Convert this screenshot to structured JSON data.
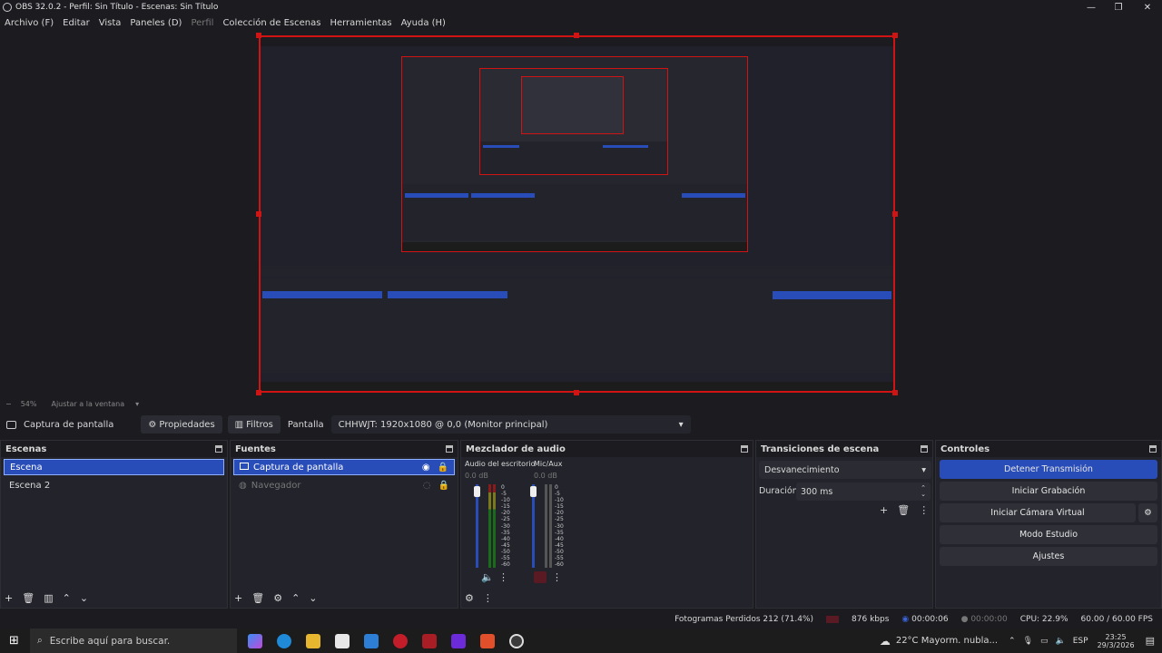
{
  "window": {
    "title": "OBS 32.0.2 - Perfil: Sin Título - Escenas: Sin Título",
    "min": "—",
    "max": "❐",
    "close": "✕"
  },
  "menu": [
    {
      "label": "Archivo (F)",
      "disabled": false
    },
    {
      "label": "Editar",
      "disabled": false
    },
    {
      "label": "Vista",
      "disabled": false
    },
    {
      "label": "Paneles (D)",
      "disabled": false
    },
    {
      "label": "Perfil",
      "disabled": true
    },
    {
      "label": "Colección de Escenas",
      "disabled": false
    },
    {
      "label": "Herramientas",
      "disabled": false
    },
    {
      "label": "Ayuda (H)",
      "disabled": false
    }
  ],
  "zoom": {
    "minus": "−",
    "value": "54%",
    "fit": "Ajustar a la ventana"
  },
  "source_bar": {
    "source_name": "Captura de pantalla",
    "properties": "Propiedades",
    "filters": "Filtros",
    "display_label": "Pantalla",
    "display_value": "CHHWJT: 1920x1080 @ 0,0 (Monitor principal)"
  },
  "scenes": {
    "title": "Escenas",
    "items": [
      {
        "label": "Escena",
        "selected": true
      },
      {
        "label": "Escena 2",
        "selected": false
      }
    ]
  },
  "sources": {
    "title": "Fuentes",
    "items": [
      {
        "label": "Captura de pantalla",
        "selected": true,
        "visible": true
      },
      {
        "label": "Navegador",
        "selected": false,
        "visible": false
      }
    ]
  },
  "mixer": {
    "title": "Mezclador de audio",
    "channels": [
      {
        "name": "Audio del escritorio",
        "db": "0.0 dB",
        "muted": false
      },
      {
        "name": "Mic/Aux",
        "db": "0.0 dB",
        "muted": true
      }
    ],
    "scale": [
      "0",
      "-5",
      "-10",
      "-15",
      "-20",
      "-25",
      "-30",
      "-35",
      "-40",
      "-45",
      "-50",
      "-55",
      "-60"
    ]
  },
  "transitions": {
    "title": "Transiciones de escena",
    "selected": "Desvanecimiento",
    "duration_label": "Duración",
    "duration_value": "300 ms"
  },
  "controls": {
    "title": "Controles",
    "buttons": [
      {
        "label": "Detener Transmisión",
        "primary": true
      },
      {
        "label": "Iniciar Grabación",
        "primary": false
      },
      {
        "label": "Iniciar Cámara Virtual",
        "primary": false
      },
      {
        "label": "Modo Estudio",
        "primary": false
      },
      {
        "label": "Ajustes",
        "primary": false
      }
    ]
  },
  "status": {
    "dropped": "Fotogramas Perdidos 212 (71.4%)",
    "bitrate": "876 kbps",
    "stream_time": "00:00:06",
    "rec_time": "00:00:00",
    "cpu": "CPU: 22.9%",
    "fps": "60.00 / 60.00 FPS"
  },
  "taskbar": {
    "search_placeholder": "Escribe aquí para buscar.",
    "weather": "22°C  Mayorm. nubla...",
    "lang": "ESP",
    "time": "23:25",
    "date": "29/3/2026"
  },
  "colors": {
    "accent": "#284cb8",
    "selection_outline": "#d01414",
    "bg": "#1b1b20",
    "panel": "#22232b"
  }
}
